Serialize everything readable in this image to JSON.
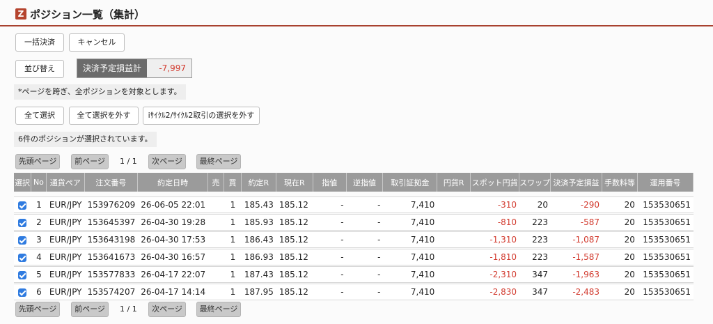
{
  "header": {
    "logo": "Z",
    "title": "ポジション一覧（集計）"
  },
  "toolbar": {
    "bulk_settle": "一括決済",
    "cancel": "キャンセル",
    "sort": "並び替え",
    "pl_label": "決済予定損益計",
    "pl_value": "-7,997"
  },
  "notes": {
    "across_pages": "*ページを跨ぎ、全ポジションを対象とします。",
    "selected_count": "6件のポジションが選択されています。"
  },
  "select_buttons": {
    "select_all": "全て選択",
    "deselect_all": "全て選択を外す",
    "deselect_cycle": "iｻｲｸﾙ2/ｻｲｸﾙ2取引の選択を外す"
  },
  "pager": {
    "first": "先頭ページ",
    "prev": "前ページ",
    "page_info": "1 / 1",
    "next": "次ページ",
    "last": "最終ページ"
  },
  "table": {
    "headers": [
      "選択",
      "No",
      "通貨ペア",
      "注文番号",
      "約定日時",
      "売",
      "買",
      "約定R",
      "現在R",
      "指値",
      "逆指値",
      "取引証拠金",
      "円貨R",
      "スポット円貨",
      "スワップ",
      "決済予定損益",
      "手数料等",
      "運用番号"
    ],
    "rows": [
      {
        "no": "1",
        "pair": "EUR/JPY",
        "order": "153976209",
        "datetime": "26-06-05 22:01",
        "sell": "",
        "buy": "1",
        "rate": "185.43",
        "current": "185.12",
        "limit": "-",
        "stop": "-",
        "margin": "7,410",
        "yen_rate": "",
        "spot": "-310",
        "swap": "20",
        "pl": "-290",
        "fee": "20",
        "op_no": "153530651"
      },
      {
        "no": "2",
        "pair": "EUR/JPY",
        "order": "153645397",
        "datetime": "26-04-30 19:28",
        "sell": "",
        "buy": "1",
        "rate": "185.93",
        "current": "185.12",
        "limit": "-",
        "stop": "-",
        "margin": "7,410",
        "yen_rate": "",
        "spot": "-810",
        "swap": "223",
        "pl": "-587",
        "fee": "20",
        "op_no": "153530651"
      },
      {
        "no": "3",
        "pair": "EUR/JPY",
        "order": "153643198",
        "datetime": "26-04-30 17:53",
        "sell": "",
        "buy": "1",
        "rate": "186.43",
        "current": "185.12",
        "limit": "-",
        "stop": "-",
        "margin": "7,410",
        "yen_rate": "",
        "spot": "-1,310",
        "swap": "223",
        "pl": "-1,087",
        "fee": "20",
        "op_no": "153530651"
      },
      {
        "no": "4",
        "pair": "EUR/JPY",
        "order": "153641673",
        "datetime": "26-04-30 16:57",
        "sell": "",
        "buy": "1",
        "rate": "186.93",
        "current": "185.12",
        "limit": "-",
        "stop": "-",
        "margin": "7,410",
        "yen_rate": "",
        "spot": "-1,810",
        "swap": "223",
        "pl": "-1,587",
        "fee": "20",
        "op_no": "153530651"
      },
      {
        "no": "5",
        "pair": "EUR/JPY",
        "order": "153577833",
        "datetime": "26-04-17 22:07",
        "sell": "",
        "buy": "1",
        "rate": "187.43",
        "current": "185.12",
        "limit": "-",
        "stop": "-",
        "margin": "7,410",
        "yen_rate": "",
        "spot": "-2,310",
        "swap": "347",
        "pl": "-1,963",
        "fee": "20",
        "op_no": "153530651"
      },
      {
        "no": "6",
        "pair": "EUR/JPY",
        "order": "153574207",
        "datetime": "26-04-17 14:14",
        "sell": "",
        "buy": "1",
        "rate": "187.95",
        "current": "185.12",
        "limit": "-",
        "stop": "-",
        "margin": "7,410",
        "yen_rate": "",
        "spot": "-2,830",
        "swap": "347",
        "pl": "-2,483",
        "fee": "20",
        "op_no": "153530651"
      }
    ]
  },
  "colors": {
    "accent": "#a8412f",
    "negative": "#d23a2e",
    "header_bg": "#9b9b9b",
    "checkbox": "#2f7be0"
  }
}
